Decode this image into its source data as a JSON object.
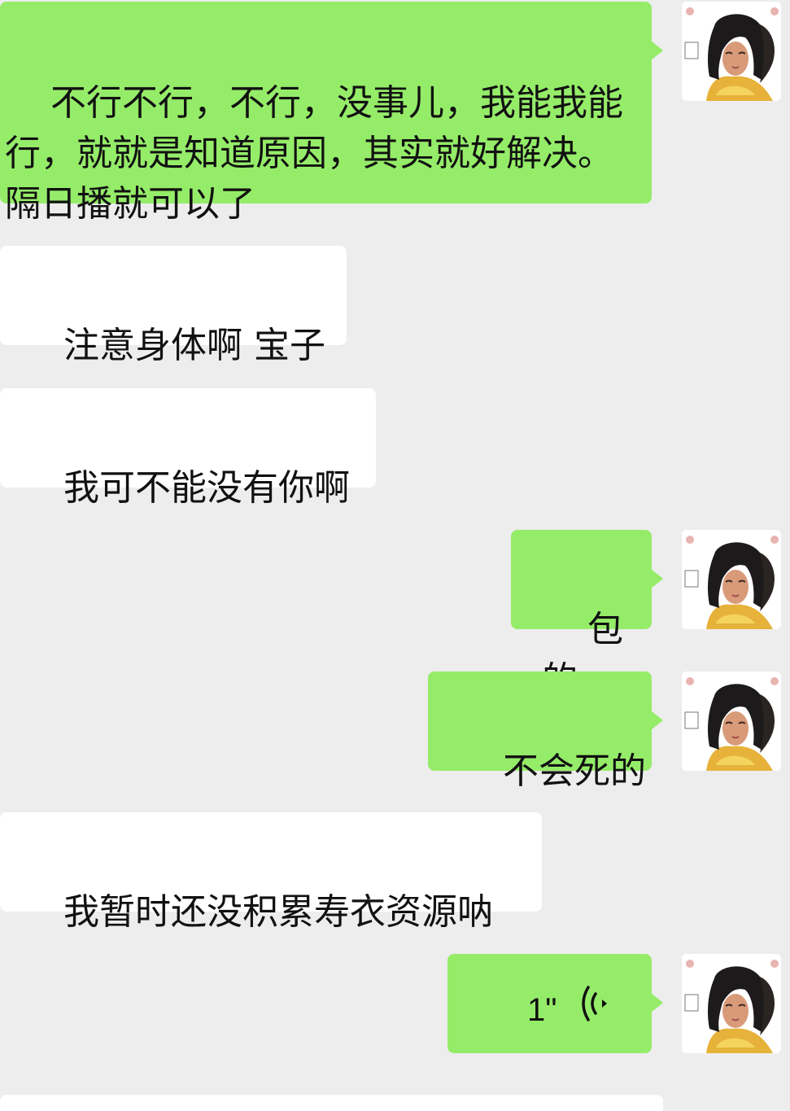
{
  "messages": [
    {
      "sender": "me",
      "text": "不行不行，不行，没事儿，我能我能行，就就是知道原因，其实就好解决。隔日播就可以了"
    },
    {
      "sender": "them",
      "text": "注意身体啊 宝子"
    },
    {
      "sender": "them",
      "text": "我可不能没有你啊"
    },
    {
      "sender": "me",
      "text": "包的"
    },
    {
      "sender": "me",
      "text": "不会死的"
    },
    {
      "sender": "them",
      "text": "我暂时还没积累寿衣资源呐"
    },
    {
      "sender": "me",
      "type": "voice",
      "duration": "1\"",
      "icon": "voice-wave-icon"
    }
  ],
  "colors": {
    "background": "#ededed",
    "my_bubble": "#95ec69",
    "their_bubble": "#ffffff"
  }
}
